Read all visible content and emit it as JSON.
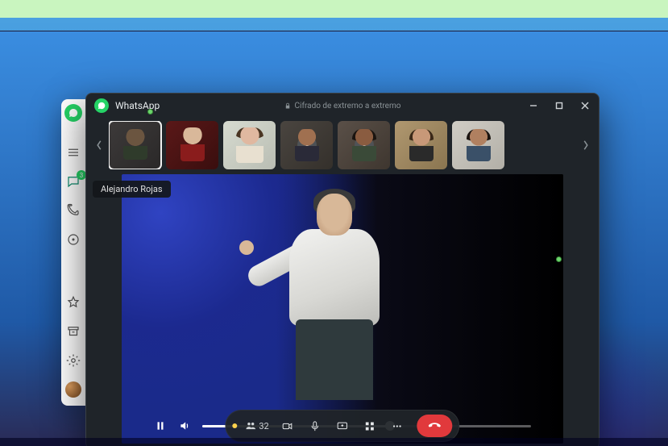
{
  "app": {
    "title": "WhatsApp",
    "encryption_label": "Cifrado de extremo a extremo"
  },
  "sidebar": {
    "chats_badge": "3"
  },
  "participants": {
    "visible": [
      {
        "name": "Alejandro Rojas",
        "active": true,
        "muted": false
      },
      {
        "name": "",
        "active": false,
        "muted": false
      },
      {
        "name": "",
        "active": false,
        "muted": false
      },
      {
        "name": "",
        "active": false,
        "muted": true
      },
      {
        "name": "",
        "active": false,
        "muted": true
      },
      {
        "name": "",
        "active": false,
        "muted": false
      },
      {
        "name": "",
        "active": false,
        "muted": false
      }
    ],
    "hover_name": "Alejandro Rojas"
  },
  "call": {
    "participant_count": "32",
    "playback_progress_pct": 57
  }
}
